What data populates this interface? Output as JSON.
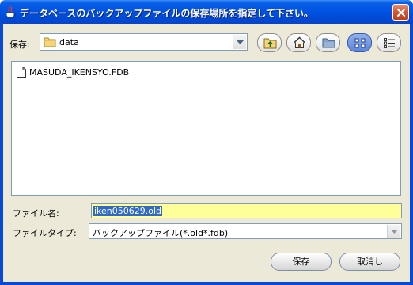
{
  "window": {
    "title": "データベースのバックアップファイルの保存場所を指定して下さい。",
    "title_color": "#ffffff",
    "titlebar_color": "#0054e3"
  },
  "location": {
    "label": "保存:",
    "value": "data"
  },
  "toolbar": {
    "buttons": [
      {
        "icon": "up-folder-icon"
      },
      {
        "icon": "home-icon"
      },
      {
        "icon": "new-folder-icon"
      },
      {
        "icon": "list-view-icon",
        "selected": true
      },
      {
        "icon": "details-view-icon"
      }
    ]
  },
  "files": [
    {
      "name": "MASUDA_IKENSYO.FDB",
      "icon": "file-icon"
    }
  ],
  "filename": {
    "label": "ファイル名:",
    "value": "iken050629.old"
  },
  "filetype": {
    "label": "ファイルタイプ:",
    "value": "バックアップファイル(*.old*.fdb)"
  },
  "actions": {
    "save_label": "保存",
    "cancel_label": "取消し"
  },
  "colors": {
    "input_highlight": "#ffff99",
    "selection": "#316ac5",
    "dialog_bg": "#ece9d8"
  }
}
